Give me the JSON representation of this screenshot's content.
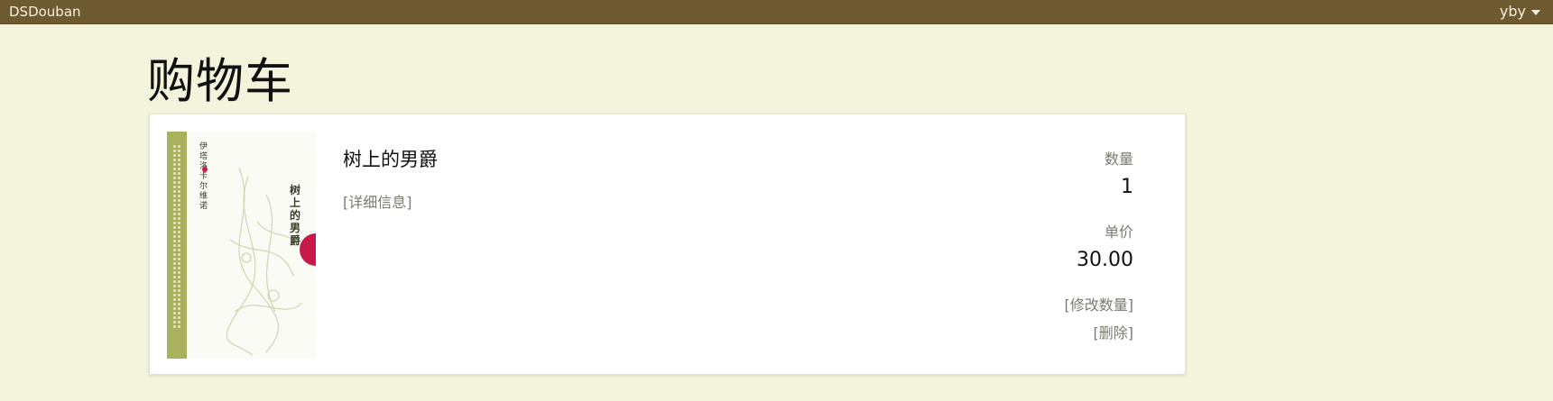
{
  "navbar": {
    "brand": "DSDouban",
    "user": "yby"
  },
  "page": {
    "title": "购物车"
  },
  "cart": {
    "items": [
      {
        "title": "树上的男爵",
        "detail_link": "[详细信息]",
        "quantity_label": "数量",
        "quantity": "1",
        "price_label": "单价",
        "price": "30.00",
        "modify_link": "[修改数量]",
        "delete_link": "[删除]",
        "cover": {
          "title_text": "树上的男爵",
          "author_text": "伊塔洛卡尔维诺",
          "spine_color": "#a9b15e",
          "accent_color": "#c8194b"
        }
      }
    ]
  },
  "colors": {
    "navbar_bg": "#6e5a30",
    "page_bg": "#f4f4dc",
    "muted_text": "#7b7b72"
  }
}
